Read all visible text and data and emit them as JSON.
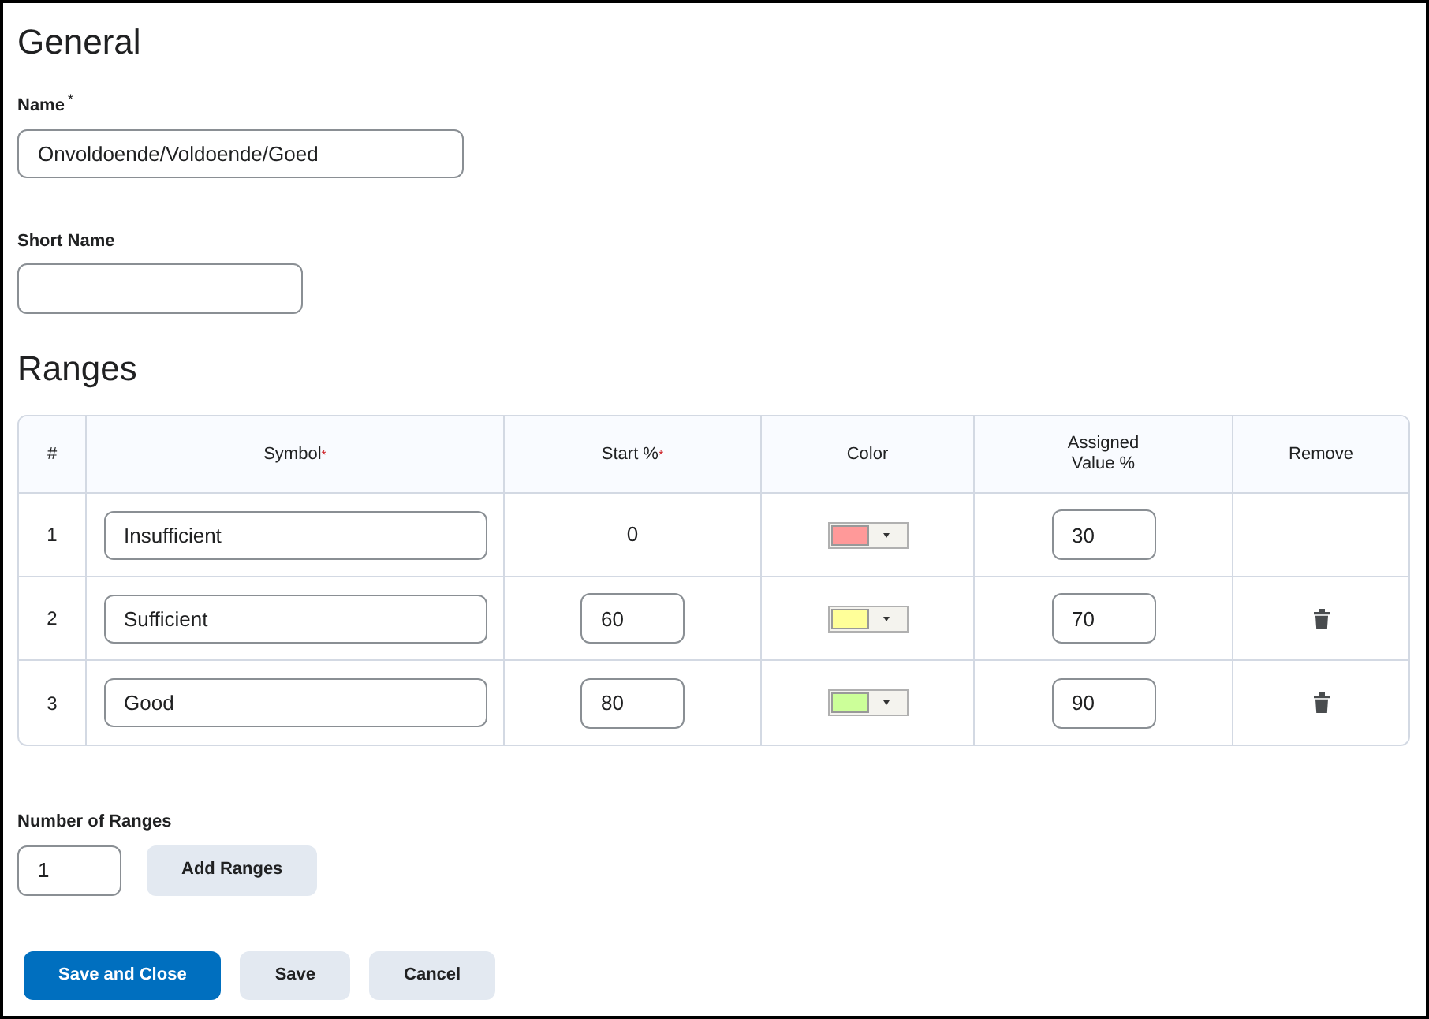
{
  "general": {
    "heading": "General",
    "name": {
      "label": "Name",
      "required_mark": "*",
      "value": "Onvoldoende/Voldoende/Goed"
    },
    "short_name": {
      "label": "Short Name"
    }
  },
  "ranges": {
    "heading": "Ranges",
    "columns": [
      {
        "label": "#"
      },
      {
        "label": "Symbol",
        "required_mark": "*"
      },
      {
        "label": "Start %",
        "required_mark": "*"
      },
      {
        "label": "Color"
      },
      {
        "label": "Assigned Value %"
      },
      {
        "label": "Remove"
      }
    ],
    "rows": [
      {
        "number": "1",
        "symbol": "Insufficient",
        "start": {
          "kind": "text",
          "value": "0"
        },
        "color": "#ff9999",
        "assigned": "30",
        "removable": false
      },
      {
        "number": "2",
        "symbol": "Sufficient",
        "start": {
          "kind": "field",
          "value": "60"
        },
        "color": "#ffff99",
        "assigned": "70",
        "removable": true
      },
      {
        "number": "3",
        "symbol": "Good",
        "start": {
          "kind": "field",
          "value": "80"
        },
        "color": "#ccff99",
        "assigned": "90",
        "removable": true
      }
    ]
  },
  "number_of_ranges": {
    "label": "Number of Ranges",
    "value": "1",
    "button": "Add Ranges"
  },
  "buttons": [
    {
      "label": "Save and Close",
      "primary": true
    },
    {
      "label": "Save",
      "primary": false
    },
    {
      "label": "Cancel",
      "primary": false
    }
  ]
}
